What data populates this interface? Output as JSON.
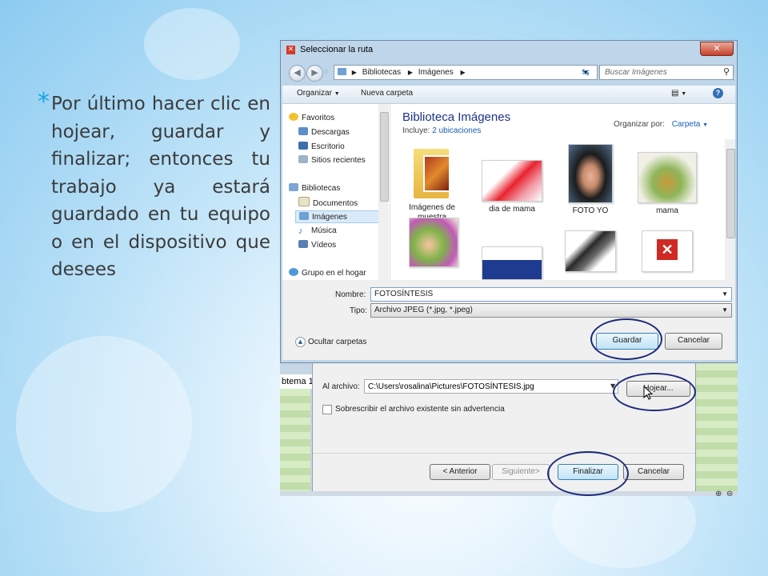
{
  "slide": {
    "text": "Por último hacer clic en hojear, guardar y finalizar; entonces tu trabajo ya estará guardado en tu equipo o en el dispositivo que desees",
    "bullet": "*"
  },
  "dialog": {
    "title": "Seleccionar la ruta",
    "close": "✕",
    "breadcrumb": [
      "Bibliotecas",
      "Imágenes"
    ],
    "search_placeholder": "Buscar Imágenes",
    "toolbar": {
      "organize": "Organizar",
      "new_folder": "Nueva carpeta"
    },
    "sidebar": {
      "favorites": "Favoritos",
      "downloads": "Descargas",
      "desktop": "Escritorio",
      "recent": "Sitios recientes",
      "libraries": "Bibliotecas",
      "documents": "Documentos",
      "images": "Imágenes",
      "music": "Música",
      "videos": "Vídeos",
      "homegroup": "Grupo en el hogar"
    },
    "library": {
      "title": "Biblioteca Imágenes",
      "includes_label": "Incluye:",
      "includes_link": "2 ubicaciones",
      "arrange_label": "Organizar por:",
      "arrange_value": "Carpeta"
    },
    "thumbnails": [
      {
        "label": "Imágenes de muestra"
      },
      {
        "label": "dia de mama"
      },
      {
        "label": "FOTO YO"
      },
      {
        "label": "mama"
      }
    ],
    "fields": {
      "name_label": "Nombre:",
      "name_value": "FOTOSÍNTESIS",
      "type_label": "Tipo:",
      "type_value": "Archivo JPEG (*.jpg, *.jpeg)",
      "hide_folders": "Ocultar carpetas",
      "save": "Guardar",
      "cancel": "Cancelar"
    }
  },
  "wizard": {
    "tab_label": "btema 1",
    "file_label": "Al archivo:",
    "file_path": "C:\\Users\\rosalina\\Pictures\\FOTOSÍNTESIS.jpg",
    "browse": "Hojear...",
    "overwrite": "Sobrescribir el archivo existente sin advertencia",
    "previous": "< Anterior",
    "next": "Siguiente>",
    "finish": "Finalizar",
    "cancel": "Cancelar"
  },
  "colors": {
    "bullet": "#19a3e4",
    "highlight_ring": "#1d2b7a",
    "link": "#1a5fb4"
  }
}
